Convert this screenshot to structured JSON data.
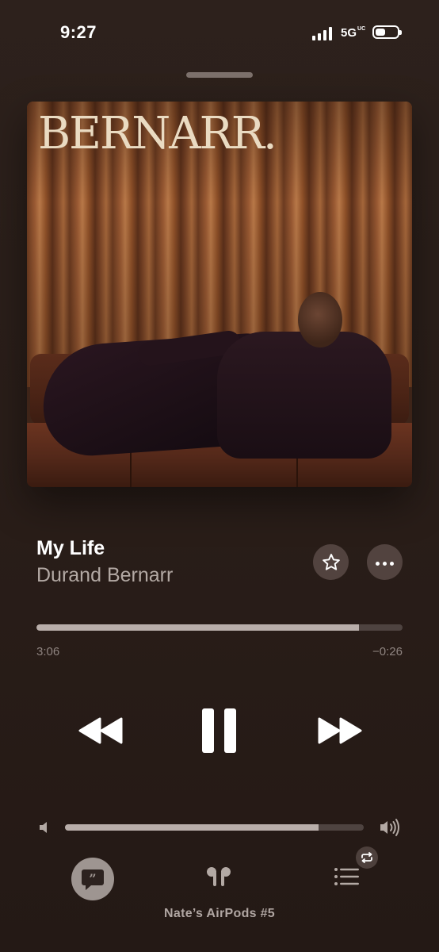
{
  "status_bar": {
    "time": "9:27",
    "network": "5G",
    "network_suffix": "UC",
    "battery_level": 0.45
  },
  "album_art": {
    "logo_text": "BERNARR."
  },
  "track": {
    "title": "My Life",
    "artist": "Durand Bernarr"
  },
  "progress": {
    "elapsed": "3:06",
    "remaining": "−0:26",
    "fraction": 0.88
  },
  "volume": {
    "fraction": 0.85
  },
  "output_device": "Nate’s AirPods #5",
  "icons": {
    "favorite": "star-icon",
    "more": "ellipsis-icon",
    "rewind": "backward-icon",
    "play_state": "pause-icon",
    "forward": "forward-icon",
    "lyrics": "quote-bubble-icon",
    "airplay": "airpods-icon",
    "queue": "list-icon",
    "repeat": "repeat-icon"
  },
  "colors": {
    "background": "#2a1e19",
    "track_fill": "#b9aeaa",
    "track_empty": "#4e4340"
  }
}
